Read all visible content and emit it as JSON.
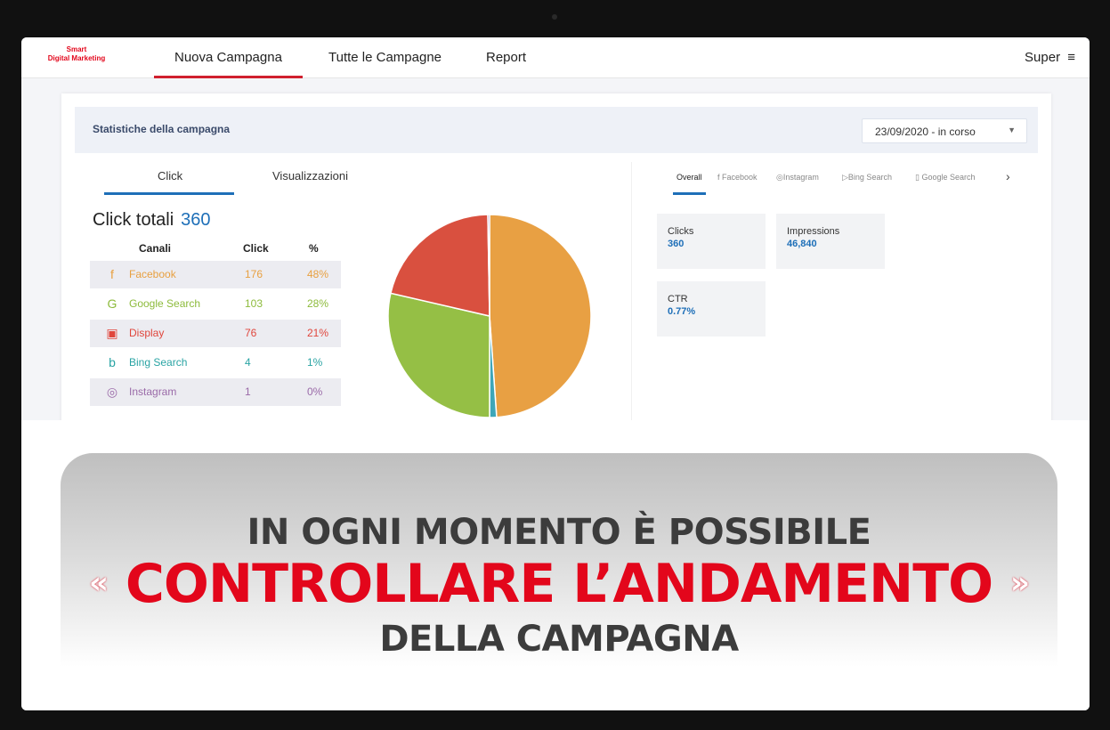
{
  "brand": {
    "line1": "Smart",
    "line2": "Digital Marketing",
    "color": "#e3061b"
  },
  "nav": {
    "tabs": [
      {
        "label": "Nuova Campagna",
        "active": true
      },
      {
        "label": "Tutte le Campagne",
        "active": false
      },
      {
        "label": "Report",
        "active": false
      }
    ],
    "user": "Super",
    "menu_icon": "menu-icon"
  },
  "campaign": {
    "title": "Statistiche della campagna",
    "date_filter": "23/09/2020 - in corso",
    "metric_tabs": [
      {
        "label": "Click",
        "active": true
      },
      {
        "label": "Visualizzazioni",
        "active": false
      }
    ],
    "total_label": "Click totali",
    "total_value": "360",
    "table": {
      "headers": [
        "Canali",
        "Click",
        "%"
      ],
      "rows": [
        {
          "icon": "facebook-icon",
          "glyph": "f",
          "channel": "Facebook",
          "clicks": "176",
          "percent": "48%",
          "color": "#e8a040"
        },
        {
          "icon": "google-search-icon",
          "glyph": "G",
          "channel": "Google Search",
          "clicks": "103",
          "percent": "28%",
          "color": "#8dbb3c"
        },
        {
          "icon": "display-icon",
          "glyph": "▣",
          "channel": "Display",
          "clicks": "76",
          "percent": "21%",
          "color": "#e0463c"
        },
        {
          "icon": "bing-search-icon",
          "glyph": "b",
          "channel": "Bing Search",
          "clicks": "4",
          "percent": "1%",
          "color": "#2aa4a4"
        },
        {
          "icon": "instagram-icon",
          "glyph": "◎",
          "channel": "Instagram",
          "clicks": "1",
          "percent": "0%",
          "color": "#9a6aa8"
        }
      ]
    },
    "pie_colors": [
      "#e8a043",
      "#3ea6b8",
      "#95bf45",
      "#d9503f",
      "#8a66a8"
    ],
    "channel_tabs": [
      {
        "label": "Overall",
        "icon": "",
        "active": true
      },
      {
        "label": "Facebook",
        "icon": "facebook-icon",
        "active": false
      },
      {
        "label": "Instagram",
        "icon": "instagram-icon",
        "active": false
      },
      {
        "label": "Bing Search",
        "icon": "bing-search-icon",
        "active": false
      },
      {
        "label": "Google Search",
        "icon": "google-search-icon",
        "active": false
      }
    ],
    "stats": [
      {
        "label": "Clicks",
        "value": "360"
      },
      {
        "label": "Impressions",
        "value": "46,840"
      },
      {
        "label": "CTR",
        "value": "0.77%"
      }
    ]
  },
  "banner": {
    "line1": "IN OGNI MOMENTO È POSSIBILE",
    "line2": "CONTROLLARE L’ANDAMENTO",
    "line3": "DELLA CAMPAGNA",
    "accent_color": "#e3061b"
  }
}
